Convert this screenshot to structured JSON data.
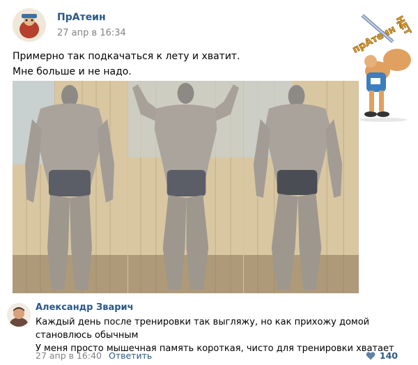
{
  "post": {
    "author": "ПрАтеин",
    "time": "27 апр в 16:34",
    "text_line1": "Примерно так подкачаться к лету и хватит.",
    "text_line2": "Мне больше и не надо."
  },
  "watermark": {
    "text_line1": "прАтеин ?",
    "text_line2": "НЕТ"
  },
  "comment": {
    "author": "Александр Зварич",
    "text_line1": "Каждый день после тренировки так выгляжу, но как прихожу домой",
    "text_line2": "становлюсь обычным",
    "text_line3": "У меня просто мышечная память короткая, чисто для тренировки хватает",
    "time": "27 апр в 16:40",
    "reply_label": "Ответить",
    "likes": "140"
  },
  "colors": {
    "link": "#2a5885",
    "muted": "#828282"
  }
}
